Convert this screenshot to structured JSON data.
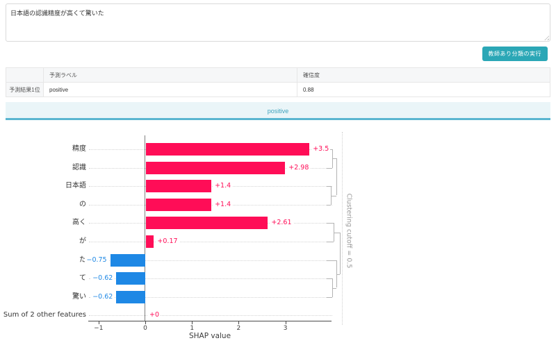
{
  "input_area": {
    "text": "日本語の認識精度が高くて驚いた"
  },
  "toolbar": {
    "run_button_label": "教師あり分類の実行"
  },
  "result_table": {
    "col_headers": [
      "",
      "予測ラベル",
      "確信度"
    ],
    "row_header": "予測結果1位",
    "rows": [
      [
        "positive",
        "0.88"
      ]
    ]
  },
  "banner": {
    "label": "positive"
  },
  "chart_data": {
    "type": "bar",
    "orientation": "horizontal",
    "xlabel": "SHAP value",
    "xlim": [
      -1.22,
      4.0
    ],
    "xticks": [
      -1,
      0,
      1,
      2,
      3
    ],
    "xtick_labels": [
      "−1",
      "0",
      "1",
      "2",
      "3"
    ],
    "categories": [
      "精度",
      "認識",
      "日本語",
      "の",
      "高く",
      "が",
      "た",
      "て",
      "驚い",
      "Sum of 2 other features"
    ],
    "values": [
      3.5,
      2.98,
      1.4,
      1.4,
      2.61,
      0.17,
      -0.75,
      -0.62,
      -0.62,
      0
    ],
    "value_labels": [
      "+3.5",
      "+2.98",
      "+1.4",
      "+1.4",
      "+2.61",
      "+0.17",
      "−0.75",
      "−0.62",
      "−0.62",
      "+0"
    ],
    "positive_color": "#ff0d57",
    "negative_color": "#1e88e5",
    "grid": "dotted row leaders",
    "legend": "none",
    "clustering": {
      "label": "Clustering cutoff = 0.5",
      "leaf_x": 470,
      "merges": [
        {
          "a": "L0",
          "b": "L1",
          "x": 478
        },
        {
          "a": "L2",
          "b": "L3",
          "x": 476
        },
        {
          "a": "M0",
          "b": "M1",
          "x": 484
        },
        {
          "a": "L4",
          "b": "L5",
          "x": 480
        },
        {
          "a": "L7",
          "b": "L8",
          "x": 478
        },
        {
          "a": "L6",
          "b": "M4",
          "x": 484
        },
        {
          "a": "M3",
          "b": "M5",
          "x": 489
        }
      ]
    }
  }
}
